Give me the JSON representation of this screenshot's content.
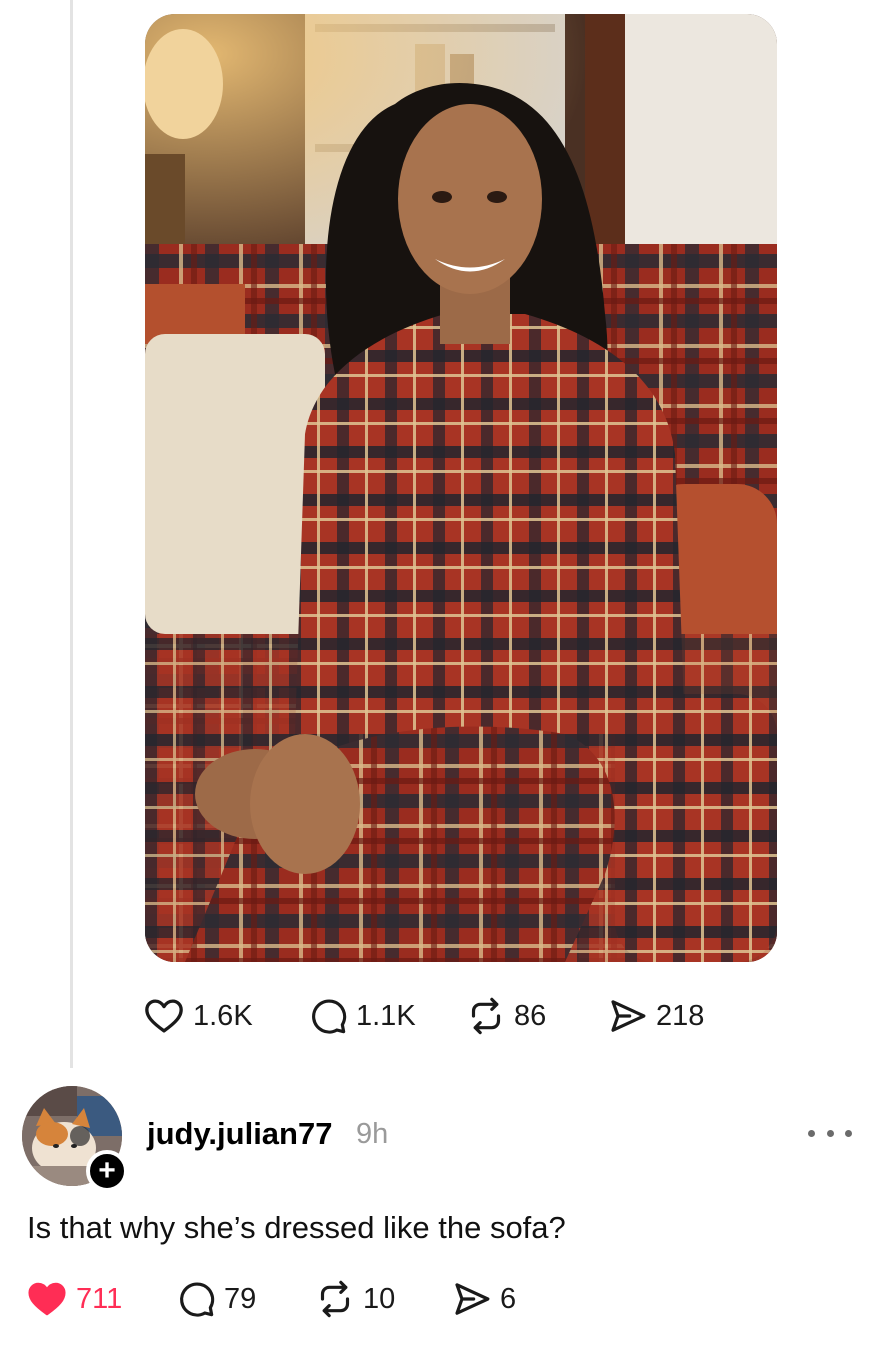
{
  "post": {
    "image_icon": "photo-woman-plaid-sofa",
    "stats": {
      "likes": "1.6K",
      "replies": "1.1K",
      "reposts": "86",
      "shares": "218"
    }
  },
  "comment": {
    "username": "judy.julian77",
    "time": "9h",
    "avatar_icon": "cat-avatar",
    "follow_symbol": "+",
    "text": "Is that why she’s dressed like the sofa?",
    "stats": {
      "likes": "711",
      "replies": "79",
      "reposts": "10",
      "shares": "6"
    },
    "liked": true
  },
  "colors": {
    "like_active": "#ff2d55",
    "icon": "#1a1a1a",
    "muted": "#9a9a9a",
    "thread_line": "#e3e3e3"
  },
  "icons": [
    "heart-icon",
    "comment-icon",
    "repost-icon",
    "send-icon",
    "more-icon",
    "plus-icon"
  ]
}
